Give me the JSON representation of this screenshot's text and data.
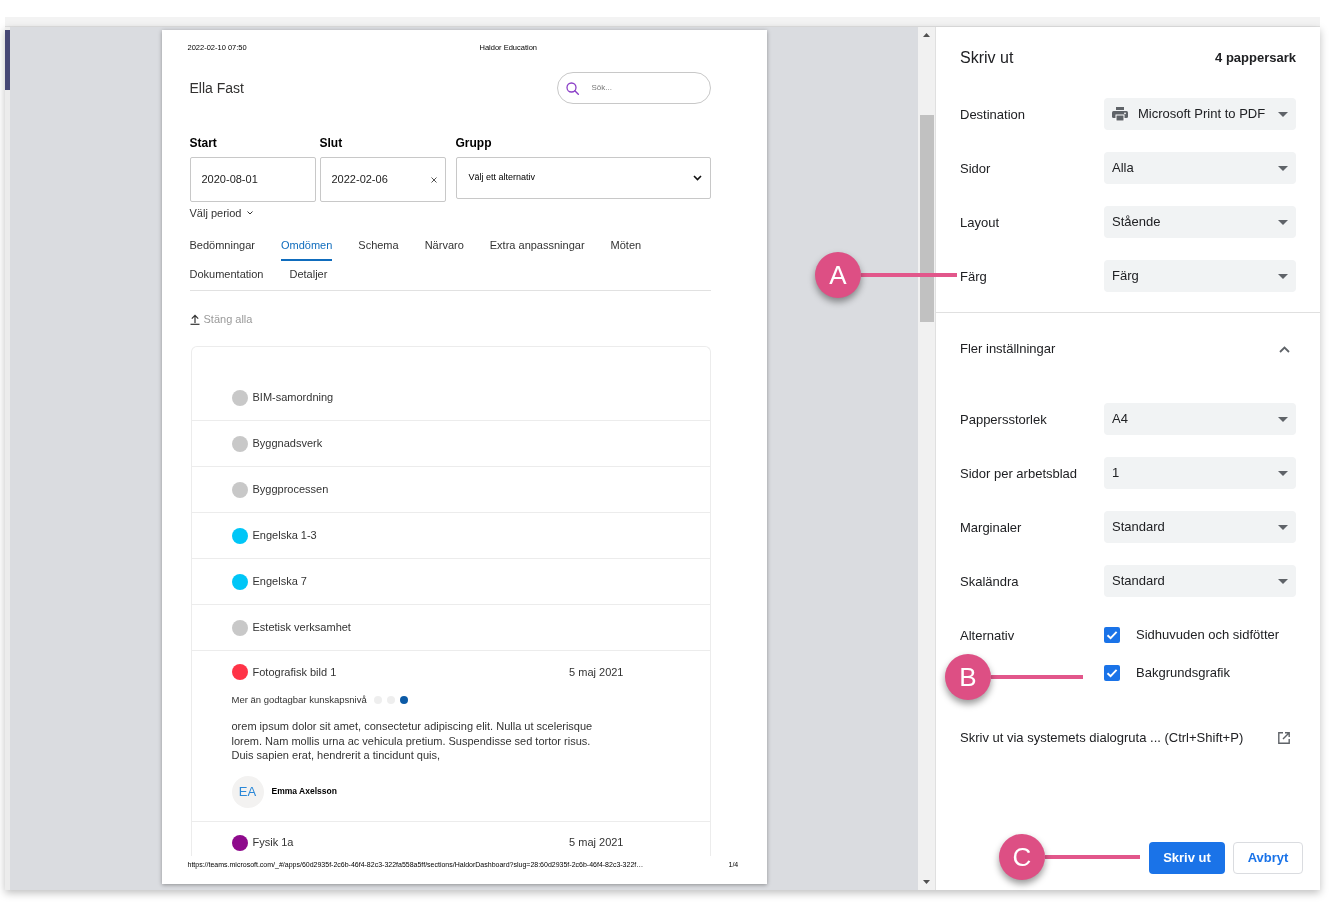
{
  "preview": {
    "header": {
      "date": "2022-02-10 07:50",
      "title": "Haldor Education"
    },
    "student_name": "Ella Fast",
    "search": {
      "placeholder": "Sök..."
    },
    "filters": [
      {
        "kind": "date",
        "label": "Start",
        "value": "2020-08-01",
        "clearable": false
      },
      {
        "kind": "date",
        "label": "Slut",
        "value": "2022-02-06",
        "clearable": true
      },
      {
        "kind": "select",
        "label": "Grupp",
        "value": "Välj ett alternativ"
      }
    ],
    "period_toggle": "Välj period",
    "tabs": [
      {
        "label": "Bedömningar",
        "selected": false
      },
      {
        "label": "Omdömen",
        "selected": true
      },
      {
        "label": "Schema",
        "selected": false
      },
      {
        "label": "Närvaro",
        "selected": false
      },
      {
        "label": "Extra anpassningar",
        "selected": false
      },
      {
        "label": "Möten",
        "selected": false
      },
      {
        "label": "Dokumentation",
        "selected": false
      },
      {
        "label": "Detaljer",
        "selected": false
      }
    ],
    "collapse_all": "Stäng alla",
    "subjects": [
      {
        "kind": "plain",
        "name": "BIM-samordning",
        "color": "#c8c8c8"
      },
      {
        "kind": "plain",
        "name": "Byggnadsverk",
        "color": "#c8c8c8"
      },
      {
        "kind": "plain",
        "name": "Byggprocessen",
        "color": "#c8c8c8"
      },
      {
        "kind": "plain",
        "name": "Engelska 1-3",
        "color": "#00c6f7"
      },
      {
        "kind": "plain",
        "name": "Engelska 7",
        "color": "#00c6f7"
      },
      {
        "kind": "plain",
        "name": "Estetisk verksamhet",
        "color": "#c8c8c8"
      },
      {
        "kind": "assessment",
        "name": "Fotografisk bild 1",
        "color": "#ff3347",
        "date": "5 maj 2021",
        "grade": {
          "label": "Mer än godtagbar kunskapsnivå",
          "scale": [
            {
              "selected": false
            },
            {
              "selected": false
            },
            {
              "selected": true
            }
          ]
        },
        "comment": "orem ipsum dolor sit amet, consectetur adipiscing elit. Nulla ut scelerisque lorem. Nam mollis urna ac vehicula pretium. Suspendisse sed tortor risus. Duis sapien erat, hendrerit a tincidunt quis,",
        "author": {
          "initials": "EA",
          "name": "Emma Axelsson"
        }
      },
      {
        "kind": "assessment",
        "name": "Fysik 1a",
        "color": "#8e0a8c",
        "date": "5 maj 2021"
      }
    ],
    "footer": {
      "url": "https://teams.microsoft.com/_#/apps/60d2935f-2c6b-46f4-82c3-322fa558a5ff/sections/HaldorDashboard?slug=28:60d2935f-2c6b-46f4-82c3-322f…",
      "page": "1/4"
    }
  },
  "print_dialog": {
    "title": "Skriv ut",
    "sheet_count": "4 pappersark",
    "settings": [
      {
        "kind": "destination",
        "label": "Destination",
        "value": "Microsoft Print to PDF"
      },
      {
        "kind": "select",
        "label": "Sidor",
        "value": "Alla"
      },
      {
        "kind": "select",
        "label": "Layout",
        "value": "Stående"
      },
      {
        "kind": "select",
        "label": "Färg",
        "value": "Färg"
      }
    ],
    "more_settings": {
      "label": "Fler inställningar",
      "expanded": true
    },
    "advanced_settings": [
      {
        "kind": "select",
        "label": "Pappersstorlek",
        "value": "A4"
      },
      {
        "kind": "select",
        "label": "Sidor per arbetsblad",
        "value": "1"
      },
      {
        "kind": "select",
        "label": "Marginaler",
        "value": "Standard"
      },
      {
        "kind": "select",
        "label": "Skaländra",
        "value": "Standard"
      }
    ],
    "options": {
      "label": "Alternativ",
      "checkboxes": [
        {
          "label": "Sidhuvuden och sidfötter",
          "checked": true
        },
        {
          "label": "Bakgrundsgrafik",
          "checked": true
        }
      ]
    },
    "system_dialog_link": "Skriv ut via systemets dialogruta ... (Ctrl+Shift+P)",
    "buttons": [
      {
        "kind": "primary",
        "label": "Skriv ut"
      },
      {
        "kind": "secondary",
        "label": "Avbryt"
      }
    ]
  },
  "callouts": [
    {
      "label": "A"
    },
    {
      "label": "B"
    },
    {
      "label": "C"
    }
  ]
}
